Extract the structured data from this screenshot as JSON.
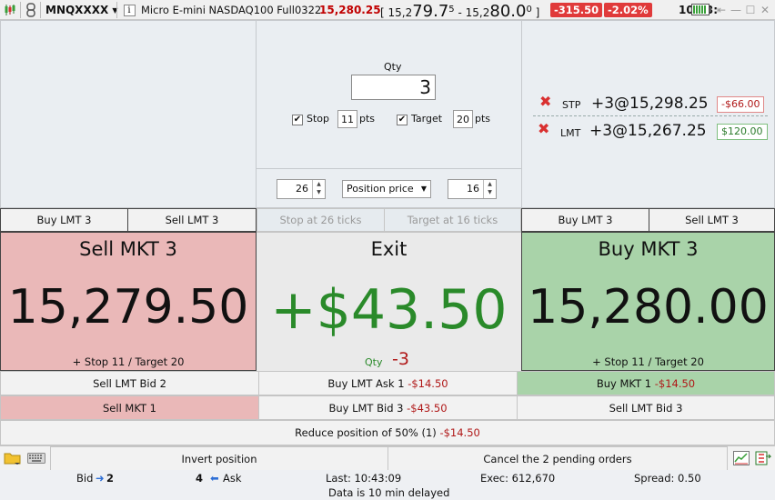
{
  "titlebar": {
    "symbol": "MNQXXXX",
    "description": "Micro E-mini NASDAQ100 Full0322",
    "last": "15,280.25",
    "bid_prefix": "15,2",
    "bid_big": "79.7",
    "bid_sup": "5",
    "ask_prefix": "15,2",
    "ask_big": "80.0",
    "ask_sup": "0",
    "change": "-315.50",
    "change_pct": "-2.02%",
    "clock": "10:43:",
    "colors": {
      "change_bg": "#e03a3a",
      "last": "#c00000"
    }
  },
  "bracket": {
    "qty_label": "Qty",
    "qty": "3",
    "stop_label": "Stop",
    "stop_value": "11",
    "stop_unit": "pts",
    "target_label": "Target",
    "target_value": "20",
    "target_unit": "pts",
    "stop_ticks": "26",
    "price_mode": "Position price",
    "target_ticks": "16"
  },
  "orders": [
    {
      "type": "STP",
      "desc": "+3@15,298.25",
      "pnl": "-$66.00",
      "pnl_color": "#b01818"
    },
    {
      "type": "LMT",
      "desc": "+3@15,267.25",
      "pnl": "$120.00",
      "pnl_color": "#2a7a2a"
    }
  ],
  "row1": {
    "left_buy": "Buy LMT 3",
    "left_sell": "Sell LMT 3",
    "stop_at": "Stop at 26 ticks",
    "target_at": "Target at 16 ticks",
    "right_buy": "Buy LMT 3",
    "right_sell": "Sell LMT 3"
  },
  "big": {
    "sell_title": "Sell MKT 3",
    "sell_price": "15,279.50",
    "sell_note": "+ Stop 11 / Target 20",
    "exit_title": "Exit",
    "exit_pnl": "+$43.50",
    "exit_qty_label": "Qty",
    "exit_qty": "-3",
    "buy_title": "Buy MKT 3",
    "buy_price": "15,280.00",
    "buy_note": "+ Stop 11 / Target 20"
  },
  "actions": {
    "r1c1": "Sell LMT Bid 2",
    "r1c2_label": "Buy LMT Ask 1",
    "r1c2_pnl": "-$14.50",
    "r1c3_label": "Buy MKT 1",
    "r1c3_pnl": "-$14.50",
    "r2c1": "Sell MKT 1",
    "r2c2_label": "Buy LMT Bid 3",
    "r2c2_pnl": "-$43.50",
    "r2c3": "Sell LMT Bid 3",
    "reduce_label": "Reduce position of 50% (1)",
    "reduce_pnl": "-$14.50",
    "invert": "Invert position",
    "cancel": "Cancel the 2 pending orders"
  },
  "status": {
    "bid_label": "Bid",
    "bid_size": "2",
    "ask_size": "4",
    "ask_label": "Ask",
    "last": "Last: 10:43:09",
    "exec": "Exec:  612,670",
    "spread": "Spread:  0.50",
    "delayed": "Data is 10 min delayed"
  },
  "icons": [
    "candlestick-icon",
    "link-icon",
    "chevron-down-icon",
    "info-icon",
    "battery-icon",
    "pin-icon",
    "minimize-icon",
    "maximize-icon",
    "close-icon",
    "folder-icon",
    "keyboard-icon",
    "chart-settings-icon",
    "export-icon",
    "arrow-right-icon",
    "arrow-left-icon",
    "remove-order-icon"
  ]
}
